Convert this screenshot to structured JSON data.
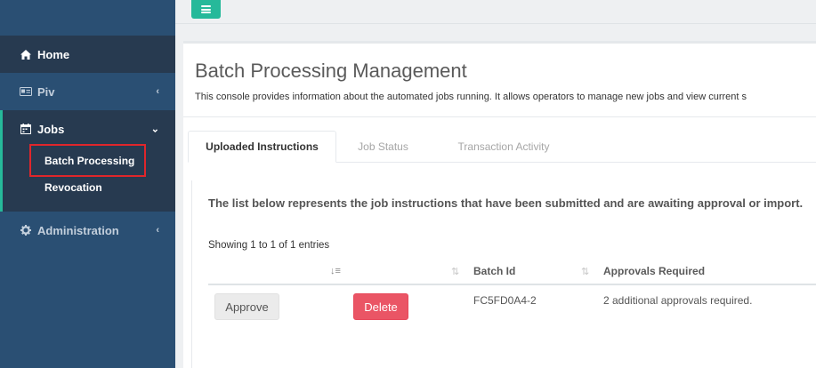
{
  "sidebar": {
    "items": [
      {
        "label": "Home",
        "icon": "home-icon"
      },
      {
        "label": "Piv",
        "icon": "id-card-icon"
      },
      {
        "label": "Jobs",
        "icon": "calendar-icon",
        "expanded": true,
        "children": [
          {
            "label": "Batch Processing",
            "selected": true
          },
          {
            "label": "Revocation"
          }
        ]
      },
      {
        "label": "Administration",
        "icon": "gear-icon"
      }
    ],
    "accent_color": "#26b99a"
  },
  "topnav": {
    "menu_icon": "hamburger-icon"
  },
  "page": {
    "title": "Batch Processing Management",
    "description": "This console provides information about the automated jobs running. It allows operators to manage new jobs and view current s"
  },
  "tabs": [
    {
      "label": "Uploaded Instructions",
      "active": true
    },
    {
      "label": "Job Status",
      "active": false
    },
    {
      "label": "Transaction Activity",
      "active": false
    }
  ],
  "uploaded": {
    "lead": "The list below represents the job instructions that have been submitted and are awaiting approval or import.",
    "showing": "Showing 1 to 1 of 1 entries",
    "columns": [
      "",
      "",
      "Batch Id",
      "Approvals Required"
    ],
    "rows": [
      {
        "approve_label": "Approve",
        "delete_label": "Delete",
        "batch_id": "FC5FD0A4-2",
        "approvals": "2 additional approvals required."
      }
    ]
  },
  "colors": {
    "sidebar_bg": "#2a4f73",
    "sidebar_active_bg": "#273a50",
    "delete_button": "#ea5565",
    "highlight_box": "#e0262b"
  }
}
